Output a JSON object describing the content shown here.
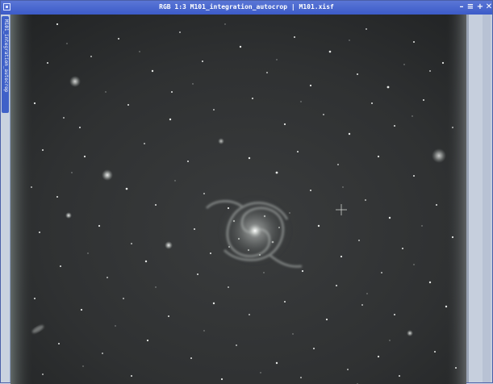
{
  "window": {
    "title": "RGB 1:3 M101_integration_autocrop | M101.xisf",
    "view_tab_label": "M101_integration_autocrop"
  },
  "titlebar_buttons": {
    "minimize": "–",
    "shade": "≡",
    "maximize": "+",
    "close": "✕"
  },
  "icons": {
    "window_system": "window-icon",
    "crosshair": "crosshair-cursor-icon"
  },
  "colors": {
    "titlebar": "#3c5bc8",
    "sidebar_tab": "#3f61c8",
    "image_background": "#2b2d2e"
  }
}
